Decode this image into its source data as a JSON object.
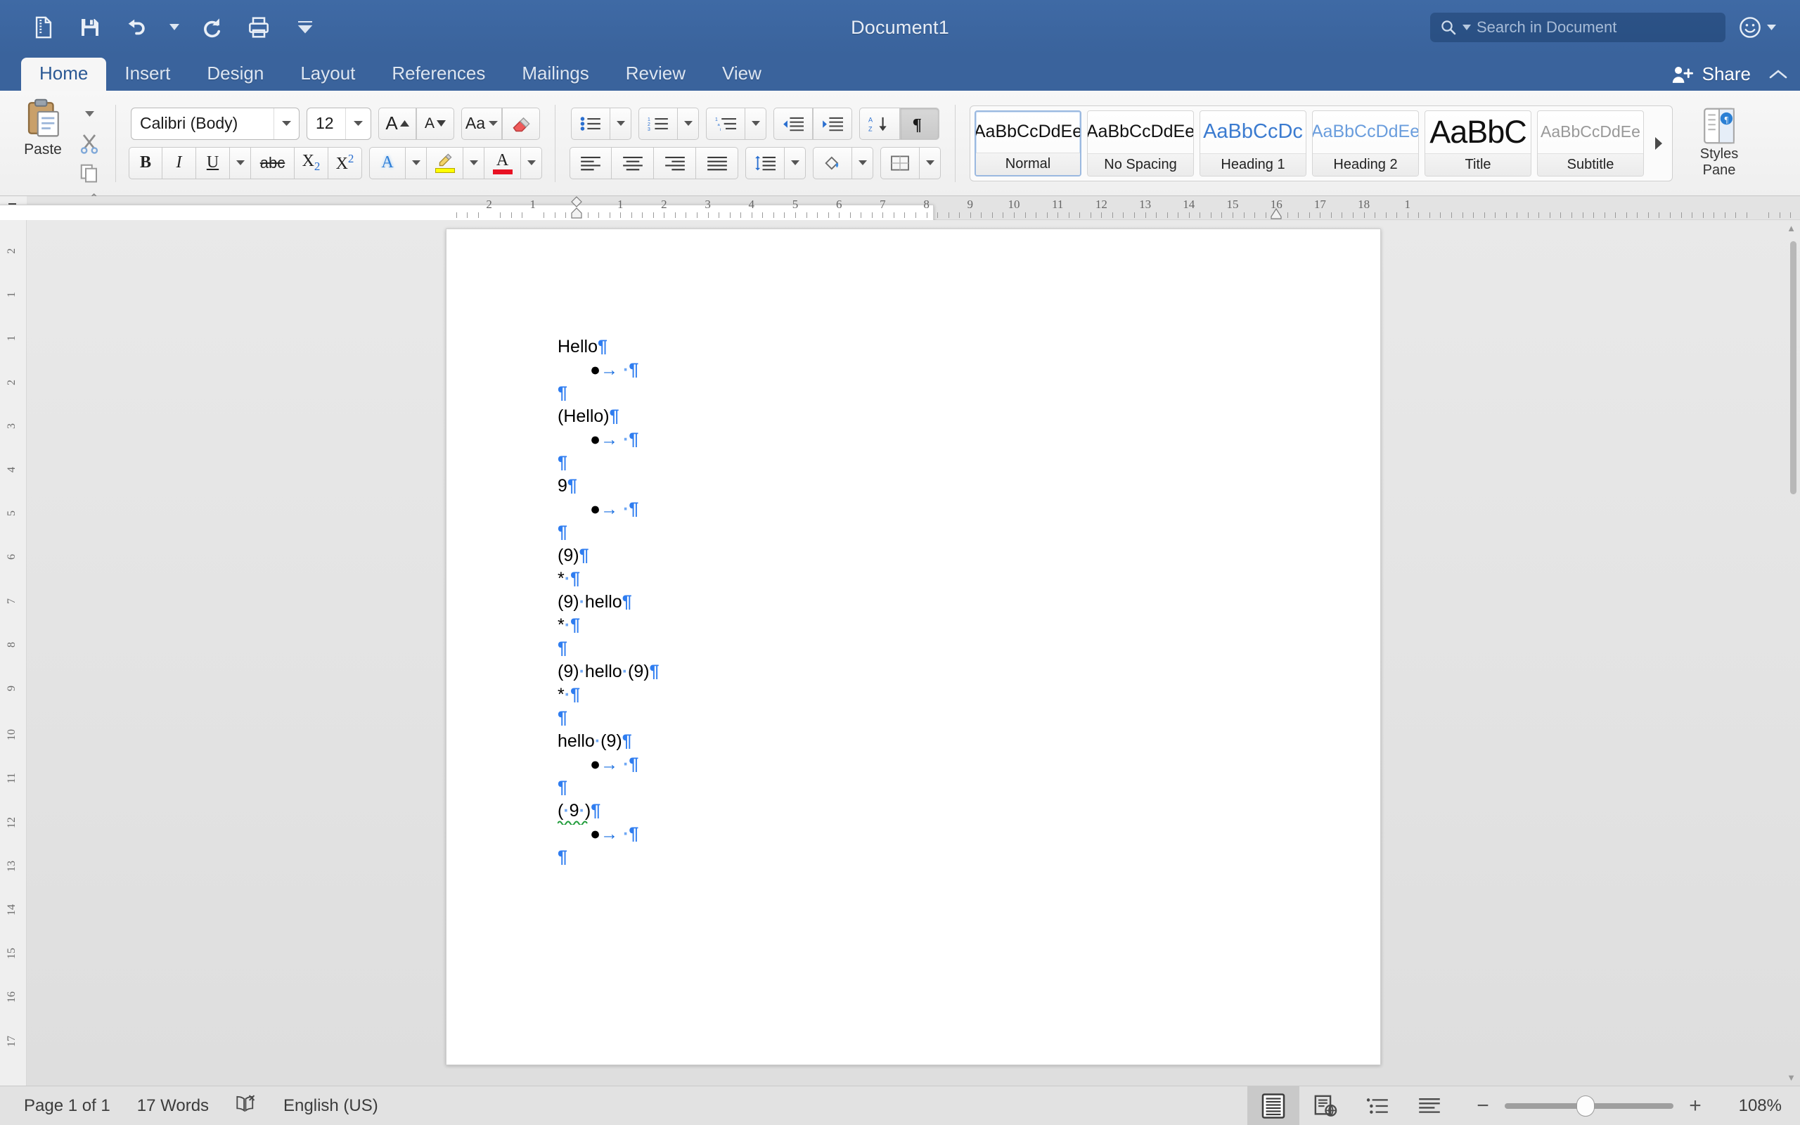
{
  "titlebar": {
    "document_title": "Document1",
    "quick_access": [
      {
        "name": "new-from-template-icon",
        "label": "New"
      },
      {
        "name": "save-icon",
        "label": "Save"
      },
      {
        "name": "undo-icon",
        "label": "Undo"
      },
      {
        "name": "undo-dropdown-caret-icon",
        "label": "Undo options"
      },
      {
        "name": "redo-icon",
        "label": "Redo"
      },
      {
        "name": "print-icon",
        "label": "Print"
      },
      {
        "name": "customize-toolbar-caret-icon",
        "label": "Customize Toolbar"
      }
    ],
    "search": {
      "placeholder": "Search in Document",
      "icon": "search-icon",
      "caret": "chevron-down-icon"
    },
    "smiley": {
      "icon": "smiley-face-icon",
      "caret": "chevron-down-icon"
    }
  },
  "tabs": [
    {
      "label": "Home",
      "active": true
    },
    {
      "label": "Insert",
      "active": false
    },
    {
      "label": "Design",
      "active": false
    },
    {
      "label": "Layout",
      "active": false
    },
    {
      "label": "References",
      "active": false
    },
    {
      "label": "Mailings",
      "active": false
    },
    {
      "label": "Review",
      "active": false
    },
    {
      "label": "View",
      "active": false
    }
  ],
  "share": {
    "label": "Share",
    "icon": "share-person-icon"
  },
  "ribbon": {
    "clipboard": {
      "paste_label": "Paste",
      "paste_icon": "clipboard-icon",
      "cut_icon": "scissors-icon",
      "copy_icon": "copy-pages-icon",
      "format_painter_icon": "paintbrush-icon",
      "paste_caret": "chevron-down-icon"
    },
    "font": {
      "font_name": "Calibri (Body)",
      "font_size": "12",
      "grow_font": "A",
      "shrink_font": "A",
      "change_case": "Aa",
      "clear_formatting_icon": "eraser-icon",
      "bold": "B",
      "italic": "I",
      "underline": "U",
      "strikethrough": "abc",
      "subscript": "X2",
      "superscript": "X2",
      "text_effects": "A",
      "highlight_icon": "highlighter-icon",
      "font_color": "A",
      "font_color_swatch": "#e81123",
      "highlight_swatch": "#ffff00"
    },
    "paragraph": {
      "bullets_icon": "bulleted-list-icon",
      "numbering_icon": "numbered-list-icon",
      "multilevel_icon": "multilevel-list-icon",
      "decrease_indent_icon": "decrease-indent-icon",
      "increase_indent_icon": "increase-indent-icon",
      "sort_icon": "sort-az-icon",
      "show_marks_icon": "pilcrow-icon",
      "show_marks_active": true,
      "align_left_icon": "align-left-icon",
      "align_center_icon": "align-center-icon",
      "align_right_icon": "align-right-icon",
      "justify_icon": "justify-icon",
      "line_spacing_icon": "line-spacing-icon",
      "shading_icon": "shading-bucket-icon",
      "borders_icon": "borders-icon"
    },
    "styles": {
      "gallery": [
        {
          "preview": "AaBbCcDdEe",
          "name": "Normal",
          "selected": true,
          "style": "sp-normal"
        },
        {
          "preview": "AaBbCcDdEe",
          "name": "No Spacing",
          "selected": false,
          "style": "sp-nospace"
        },
        {
          "preview": "AaBbCcDc",
          "name": "Heading 1",
          "selected": false,
          "style": "sp-h1"
        },
        {
          "preview": "AaBbCcDdEe",
          "name": "Heading 2",
          "selected": false,
          "style": "sp-h2"
        },
        {
          "preview": "AaBbC",
          "name": "Title",
          "selected": false,
          "style": "sp-title"
        },
        {
          "preview": "AaBbCcDdEe",
          "name": "Subtitle",
          "selected": false,
          "style": "sp-sub"
        }
      ],
      "more_icon": "gallery-more-arrow-icon",
      "pane_label_line1": "Styles",
      "pane_label_line2": "Pane",
      "pane_icon": "styles-pane-icon"
    }
  },
  "ruler": {
    "horizontal_labels": [
      "2",
      "1",
      "1",
      "2",
      "3",
      "4",
      "5",
      "6",
      "7",
      "8",
      "9",
      "10",
      "11",
      "12",
      "13",
      "14",
      "15",
      "16",
      "17",
      "18",
      "1"
    ],
    "vertical_labels": [
      "2",
      "1",
      "1",
      "2",
      "3",
      "4",
      "5",
      "6",
      "7",
      "8",
      "9",
      "10",
      "11",
      "12",
      "13",
      "14",
      "15",
      "16",
      "17"
    ],
    "left_indent_marker": "indent-marker-icon",
    "right_indent_marker": "indent-marker-icon"
  },
  "document": {
    "lines": [
      {
        "indent": false,
        "parts": [
          {
            "t": "Hello",
            "c": "txt"
          },
          {
            "t": "¶",
            "c": "pm"
          }
        ]
      },
      {
        "indent": true,
        "parts": [
          {
            "t": "●",
            "c": "bul"
          },
          {
            "t": "→",
            "c": "arr"
          },
          {
            "t": " ",
            "c": "txt"
          },
          {
            "t": "·",
            "c": "dot"
          },
          {
            "t": "¶",
            "c": "pm"
          }
        ]
      },
      {
        "indent": false,
        "parts": [
          {
            "t": "¶",
            "c": "pm"
          }
        ]
      },
      {
        "indent": false,
        "parts": [
          {
            "t": "(Hello)",
            "c": "txt"
          },
          {
            "t": "¶",
            "c": "pm"
          }
        ]
      },
      {
        "indent": true,
        "parts": [
          {
            "t": "●",
            "c": "bul"
          },
          {
            "t": "→",
            "c": "arr"
          },
          {
            "t": " ",
            "c": "txt"
          },
          {
            "t": "·",
            "c": "dot"
          },
          {
            "t": "¶",
            "c": "pm"
          }
        ]
      },
      {
        "indent": false,
        "parts": [
          {
            "t": "¶",
            "c": "pm"
          }
        ]
      },
      {
        "indent": false,
        "parts": [
          {
            "t": "9",
            "c": "txt"
          },
          {
            "t": "¶",
            "c": "pm"
          }
        ]
      },
      {
        "indent": true,
        "parts": [
          {
            "t": "●",
            "c": "bul"
          },
          {
            "t": "→",
            "c": "arr"
          },
          {
            "t": " ",
            "c": "txt"
          },
          {
            "t": "·",
            "c": "dot"
          },
          {
            "t": "¶",
            "c": "pm"
          }
        ]
      },
      {
        "indent": false,
        "parts": [
          {
            "t": "¶",
            "c": "pm"
          }
        ]
      },
      {
        "indent": false,
        "parts": [
          {
            "t": "(9)",
            "c": "txt"
          },
          {
            "t": "¶",
            "c": "pm"
          }
        ]
      },
      {
        "indent": false,
        "parts": [
          {
            "t": "*",
            "c": "txt"
          },
          {
            "t": "·",
            "c": "dot"
          },
          {
            "t": "¶",
            "c": "pm"
          }
        ]
      },
      {
        "indent": false,
        "parts": [
          {
            "t": "(9)",
            "c": "txt"
          },
          {
            "t": "·",
            "c": "dot"
          },
          {
            "t": "hello",
            "c": "txt"
          },
          {
            "t": "¶",
            "c": "pm"
          }
        ]
      },
      {
        "indent": false,
        "parts": [
          {
            "t": "*",
            "c": "txt"
          },
          {
            "t": "·",
            "c": "dot"
          },
          {
            "t": "¶",
            "c": "pm"
          }
        ]
      },
      {
        "indent": false,
        "parts": [
          {
            "t": "¶",
            "c": "pm"
          }
        ]
      },
      {
        "indent": false,
        "parts": [
          {
            "t": "(9)",
            "c": "txt"
          },
          {
            "t": "·",
            "c": "dot"
          },
          {
            "t": "hello",
            "c": "txt"
          },
          {
            "t": "·",
            "c": "dot"
          },
          {
            "t": "(9)",
            "c": "txt"
          },
          {
            "t": "¶",
            "c": "pm"
          }
        ]
      },
      {
        "indent": false,
        "parts": [
          {
            "t": "*",
            "c": "txt"
          },
          {
            "t": "·",
            "c": "dot"
          },
          {
            "t": "¶",
            "c": "pm"
          }
        ]
      },
      {
        "indent": false,
        "parts": [
          {
            "t": "¶",
            "c": "pm"
          }
        ]
      },
      {
        "indent": false,
        "parts": [
          {
            "t": "hello",
            "c": "txt"
          },
          {
            "t": "·",
            "c": "dot"
          },
          {
            "t": "(9)",
            "c": "txt"
          },
          {
            "t": "¶",
            "c": "pm"
          }
        ]
      },
      {
        "indent": true,
        "parts": [
          {
            "t": "●",
            "c": "bul"
          },
          {
            "t": "→",
            "c": "arr"
          },
          {
            "t": " ",
            "c": "txt"
          },
          {
            "t": "·",
            "c": "dot"
          },
          {
            "t": "¶",
            "c": "pm"
          }
        ]
      },
      {
        "indent": false,
        "parts": [
          {
            "t": "¶",
            "c": "pm"
          }
        ]
      },
      {
        "indent": false,
        "spell": true,
        "parts": [
          {
            "t": "(",
            "c": "txt"
          },
          {
            "t": "·",
            "c": "dot"
          },
          {
            "t": "9",
            "c": "txt"
          },
          {
            "t": "·",
            "c": "dot"
          },
          {
            "t": ")",
            "c": "txt"
          },
          {
            "t": "¶",
            "c": "pm"
          }
        ]
      },
      {
        "indent": true,
        "parts": [
          {
            "t": "●",
            "c": "bul"
          },
          {
            "t": "→",
            "c": "arr"
          },
          {
            "t": " ",
            "c": "txt"
          },
          {
            "t": "·",
            "c": "dot"
          },
          {
            "t": "¶",
            "c": "pm"
          }
        ]
      },
      {
        "indent": false,
        "parts": [
          {
            "t": "¶",
            "c": "pm"
          }
        ]
      }
    ]
  },
  "status": {
    "page": "Page 1 of 1",
    "words": "17 Words",
    "proofing_icon": "proofing-errors-icon",
    "language": "English (US)",
    "views": [
      {
        "name": "print-layout-view-icon",
        "active": true
      },
      {
        "name": "web-layout-view-icon",
        "active": false
      },
      {
        "name": "outline-view-icon",
        "active": false
      },
      {
        "name": "draft-view-icon",
        "active": false
      }
    ],
    "zoom_out": "−",
    "zoom_in": "+",
    "zoom_percent": "108%"
  }
}
